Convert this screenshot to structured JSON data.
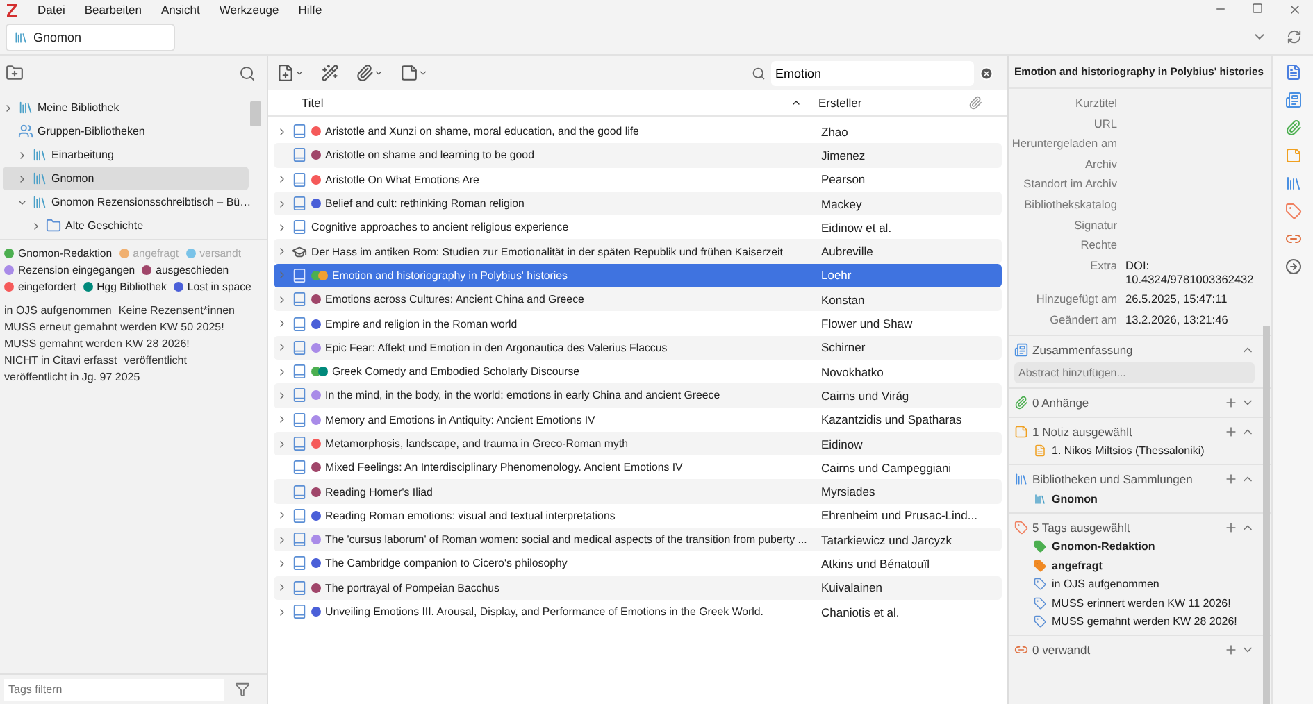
{
  "menu": [
    "Datei",
    "Bearbeiten",
    "Ansicht",
    "Werkzeuge",
    "Hilfe"
  ],
  "tab": {
    "label": "Gnomon"
  },
  "libraries": [
    {
      "label": "Meine Bibliothek",
      "kind": "library",
      "expanded": false,
      "selected": false
    },
    {
      "label": "Gruppen-Bibliotheken",
      "kind": "groups",
      "children": [
        {
          "label": "Einarbeitung",
          "kind": "library",
          "expanded": false,
          "selected": false
        },
        {
          "label": "Gnomon",
          "kind": "library",
          "expanded": false,
          "selected": true
        },
        {
          "label": "Gnomon Rezensionsschreibtisch – Bü…",
          "kind": "library",
          "expanded": true,
          "selected": false,
          "children": [
            {
              "label": "Alte Geschichte",
              "kind": "folder",
              "expanded": false,
              "selected": false
            }
          ]
        }
      ]
    }
  ],
  "colored_tags": [
    {
      "label": "Gnomon-Redaktion",
      "color": "#4caf50",
      "disabled": false
    },
    {
      "label": "angefragt",
      "color": "#f0b070",
      "disabled": true
    },
    {
      "label": "versandt",
      "color": "#7ac3e8",
      "disabled": true
    },
    {
      "label": "Rezension eingegangen",
      "color": "#a98be8",
      "disabled": false
    },
    {
      "label": "ausgeschieden",
      "color": "#a0466a",
      "disabled": false
    },
    {
      "label": "eingefordert",
      "color": "#f55a5a",
      "disabled": false
    },
    {
      "label": "Hgg Bibliothek",
      "color": "#00897b",
      "disabled": false
    },
    {
      "label": "Lost in space",
      "color": "#4a5fd8",
      "disabled": false
    }
  ],
  "plain_tags": [
    "in OJS aufgenommen",
    "Keine Rezensent*innen",
    "MUSS erneut gemahnt werden KW 50 2025!",
    "MUSS gemahnt werden KW 28 2026!",
    "NICHT in Citavi erfasst",
    "veröffentlicht",
    "veröffentlicht in Jg. 97 2025"
  ],
  "tag_filter": {
    "placeholder": "Tags filtern"
  },
  "search": {
    "value": "Emotion"
  },
  "table": {
    "columns": [
      "Titel",
      "Ersteller"
    ],
    "rows": [
      {
        "title": "Aristotle and Xunzi on shame, moral education, and the good life",
        "creator": "Zhao",
        "kind": "book",
        "expanded": false,
        "selected": false,
        "tags": [
          {
            "color": "#f55a5a"
          }
        ]
      },
      {
        "title": "Aristotle on shame and learning to be good",
        "creator": "Jimenez",
        "kind": "book",
        "selected": false,
        "tags": [
          {
            "color": "#a0466a"
          }
        ]
      },
      {
        "title": "Aristotle On What Emotions Are",
        "creator": "Pearson",
        "kind": "book",
        "expanded": false,
        "selected": false,
        "tags": [
          {
            "color": "#f55a5a"
          }
        ]
      },
      {
        "title": "Belief and cult: rethinking Roman religion",
        "creator": "Mackey",
        "kind": "book",
        "expanded": false,
        "selected": false,
        "tags": [
          {
            "color": "#4a5fd8"
          }
        ]
      },
      {
        "title": "Cognitive approaches to ancient religious experience",
        "creator": "Eidinow et al.",
        "kind": "book",
        "expanded": false,
        "selected": false,
        "tags": []
      },
      {
        "title": "Der Hass im antiken Rom: Studien zur Emotionalität in der späten Republik und frühen Kaiserzeit",
        "creator": "Aubreville",
        "kind": "thesis",
        "expanded": false,
        "selected": false,
        "tags": []
      },
      {
        "title": "Emotion and historiography in Polybius' histories",
        "creator": "Loehr",
        "kind": "book",
        "expanded": false,
        "selected": true,
        "tags": [
          {
            "color": "#4caf50"
          },
          {
            "color": "#f0a030"
          }
        ]
      },
      {
        "title": "Emotions across Cultures: Ancient China and Greece",
        "creator": "Konstan",
        "kind": "book",
        "expanded": false,
        "selected": false,
        "tags": [
          {
            "color": "#a0466a"
          }
        ]
      },
      {
        "title": "Empire and religion in the Roman world",
        "creator": "Flower und Shaw",
        "kind": "book",
        "expanded": false,
        "selected": false,
        "tags": [
          {
            "color": "#4a5fd8"
          }
        ]
      },
      {
        "title": "Epic Fear: Affekt und Emotion in den Argonautica des Valerius Flaccus",
        "creator": "Schirner",
        "kind": "book",
        "expanded": false,
        "selected": false,
        "tags": [
          {
            "color": "#a98be8"
          }
        ]
      },
      {
        "title": "Greek Comedy and Embodied Scholarly Discourse",
        "creator": "Novokhatko",
        "kind": "book",
        "expanded": false,
        "selected": false,
        "tags": [
          {
            "color": "#4caf50"
          },
          {
            "color": "#00897b"
          }
        ]
      },
      {
        "title": "In the mind, in the body, in the world: emotions in early China and ancient Greece",
        "creator": "Cairns und Virág",
        "kind": "book",
        "expanded": false,
        "selected": false,
        "tags": [
          {
            "color": "#a98be8"
          }
        ]
      },
      {
        "title": "Memory and Emotions in Antiquity: Ancient Emotions IV",
        "creator": "Kazantzidis und Spatharas",
        "kind": "book",
        "expanded": false,
        "selected": false,
        "tags": [
          {
            "color": "#a98be8"
          }
        ]
      },
      {
        "title": "Metamorphosis, landscape, and trauma in Greco-Roman myth",
        "creator": "Eidinow",
        "kind": "book",
        "expanded": false,
        "selected": false,
        "tags": [
          {
            "color": "#f55a5a"
          }
        ]
      },
      {
        "title": "Mixed Feelings: An Interdisciplinary Phenomenology. Ancient Emotions IV",
        "creator": "Cairns und Campeggiani",
        "kind": "book",
        "selected": false,
        "tags": [
          {
            "color": "#a0466a"
          }
        ]
      },
      {
        "title": "Reading Homer's Iliad",
        "creator": "Myrsiades",
        "kind": "book",
        "selected": false,
        "tags": [
          {
            "color": "#a0466a"
          }
        ]
      },
      {
        "title": "Reading Roman emotions: visual and textual interpretations",
        "creator": "Ehrenheim und Prusac-Lind...",
        "kind": "book",
        "expanded": false,
        "selected": false,
        "tags": [
          {
            "color": "#4a5fd8"
          }
        ]
      },
      {
        "title": "The 'cursus laborum' of Roman women: social and medical aspects of the transition from puberty ...",
        "creator": "Tatarkiewicz und Jarcyzk",
        "kind": "book",
        "expanded": false,
        "selected": false,
        "tags": [
          {
            "color": "#a98be8"
          }
        ]
      },
      {
        "title": "The Cambridge companion to Cicero's philosophy",
        "creator": "Atkins und Bénatouïl",
        "kind": "book",
        "expanded": false,
        "selected": false,
        "tags": [
          {
            "color": "#4a5fd8"
          }
        ]
      },
      {
        "title": "The portrayal of Pompeian Bacchus",
        "creator": "Kuivalainen",
        "kind": "book",
        "expanded": false,
        "selected": false,
        "tags": [
          {
            "color": "#a0466a"
          }
        ]
      },
      {
        "title": "Unveiling Emotions III. Arousal, Display, and Performance of Emotions in the Greek World.",
        "creator": "Chaniotis et al.",
        "kind": "book",
        "expanded": false,
        "selected": false,
        "tags": [
          {
            "color": "#4a5fd8"
          }
        ]
      }
    ]
  },
  "item_pane": {
    "title": "Emotion and historiography in Polybius' histories",
    "fields": [
      {
        "label": "Kurztitel"
      },
      {
        "label": "URL"
      },
      {
        "label": "Heruntergeladen am"
      },
      {
        "label": "Archiv"
      },
      {
        "label": "Standort im Archiv"
      },
      {
        "label": "Bibliothekskatalog"
      },
      {
        "label": "Signatur"
      },
      {
        "label": "Rechte"
      },
      {
        "label": "Extra",
        "value": "DOI: 10.4324/9781003362432"
      },
      {
        "label": "Hinzugefügt am",
        "value": "26.5.2025, 15:47:11"
      },
      {
        "label": "Geändert am",
        "value": "13.2.2026, 13:21:46"
      }
    ],
    "sections": [
      {
        "kind": "abstract",
        "title": "Zusammenfassung",
        "expanded": true,
        "placeholder": "Abstract hinzufügen..."
      },
      {
        "kind": "attachments",
        "title": "0 Anhänge",
        "expanded": false
      },
      {
        "kind": "notes",
        "title": "1 Notiz ausgewählt",
        "expanded": true,
        "items": [
          {
            "label": "1. Nikos Miltsios (Thessaloniki)"
          }
        ]
      },
      {
        "kind": "libraries",
        "title": "Bibliotheken und Sammlungen",
        "expanded": true,
        "items": [
          {
            "label": "Gnomon"
          }
        ]
      },
      {
        "kind": "tags",
        "title": "5 Tags ausgewählt",
        "expanded": true,
        "items": [
          {
            "label": "Gnomon-Redaktion",
            "color": "#4caf50"
          },
          {
            "label": "angefragt",
            "color": "#f08a24"
          },
          {
            "label": "in OJS aufgenommen"
          },
          {
            "label": "MUSS erinnert werden KW 11 2026!"
          },
          {
            "label": "MUSS gemahnt werden KW 28 2026!"
          }
        ]
      },
      {
        "kind": "related",
        "title": "0 verwandt",
        "expanded": false
      }
    ]
  }
}
